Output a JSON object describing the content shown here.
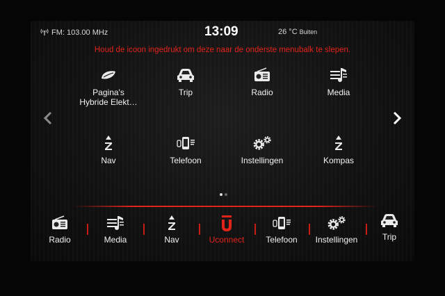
{
  "status": {
    "radio": "FM: 103.00 MHz",
    "time": "13:09",
    "temperature": "26 °C",
    "temperature_label": "Buiten"
  },
  "hint": "Houd de icoon ingedrukt om deze naar de onderste menubalk te slepen.",
  "apps": [
    {
      "label": "Pagina's\nHybride Elekt…",
      "icon": "eco-leaf-icon"
    },
    {
      "label": "Trip",
      "icon": "car-icon"
    },
    {
      "label": "Radio",
      "icon": "radio-icon"
    },
    {
      "label": "Media",
      "icon": "media-icon"
    },
    {
      "label": "Nav",
      "icon": "compass-z-icon"
    },
    {
      "label": "Telefoon",
      "icon": "phone-icon"
    },
    {
      "label": "Instellingen",
      "icon": "gear-icon"
    },
    {
      "label": "Kompas",
      "icon": "compass-icon"
    }
  ],
  "pager": {
    "pages": 2,
    "current": 1
  },
  "dock": [
    {
      "label": "Radio",
      "icon": "radio-icon"
    },
    {
      "label": "Media",
      "icon": "media-icon"
    },
    {
      "label": "Nav",
      "icon": "compass-z-icon"
    },
    {
      "label": "Uconnect",
      "icon": "uconnect-icon",
      "active": true
    },
    {
      "label": "Telefoon",
      "icon": "phone-icon"
    },
    {
      "label": "Instellingen",
      "icon": "gear-icon"
    },
    {
      "label": "Trip",
      "icon": "car-icon"
    }
  ],
  "colors": {
    "accent": "#e2231a",
    "text": "#f2f2f2",
    "background": "#121212"
  }
}
